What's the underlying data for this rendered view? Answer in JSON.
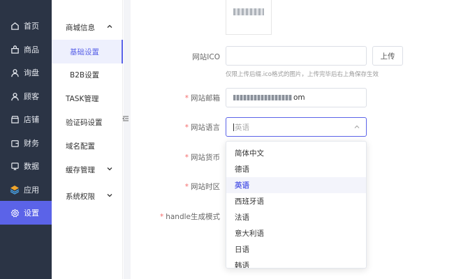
{
  "nav": {
    "items": [
      {
        "label": "首页",
        "icon": "home-icon"
      },
      {
        "label": "商品",
        "icon": "bag-icon"
      },
      {
        "label": "询盘",
        "icon": "user-icon"
      },
      {
        "label": "顾客",
        "icon": "person-icon"
      },
      {
        "label": "店铺",
        "icon": "store-icon"
      },
      {
        "label": "财务",
        "icon": "wallet-icon"
      },
      {
        "label": "数据",
        "icon": "monitor-icon"
      },
      {
        "label": "应用",
        "icon": "layers-icon"
      },
      {
        "label": "设置",
        "icon": "gear-icon"
      }
    ],
    "active_color": "#5b63e8"
  },
  "submenu": {
    "group_label": "商城信息",
    "children": [
      "基础设置",
      "B2B设置"
    ],
    "items": [
      "TASK管理",
      "验证码设置",
      "域名配置"
    ],
    "cache_label": "缓存管理",
    "perm_label": "系统权限"
  },
  "form": {
    "ico_label": "网站ICO",
    "upload_label": "上传",
    "ico_hint": "仅限上传后缀.ico格式的图片，上传完毕后右上角保存生效",
    "email_label": "网站邮箱",
    "email_value_suffix": "om",
    "language_label": "网站语言",
    "language_value": "英语",
    "currency_label": "网站货币",
    "timezone_label": "网站时区",
    "handle_label": "handle生成模式"
  },
  "dropdown": {
    "options": [
      "简体中文",
      "德语",
      "英语",
      "西班牙语",
      "法语",
      "意大利语",
      "日语",
      "韩语"
    ],
    "selected": "英语"
  }
}
